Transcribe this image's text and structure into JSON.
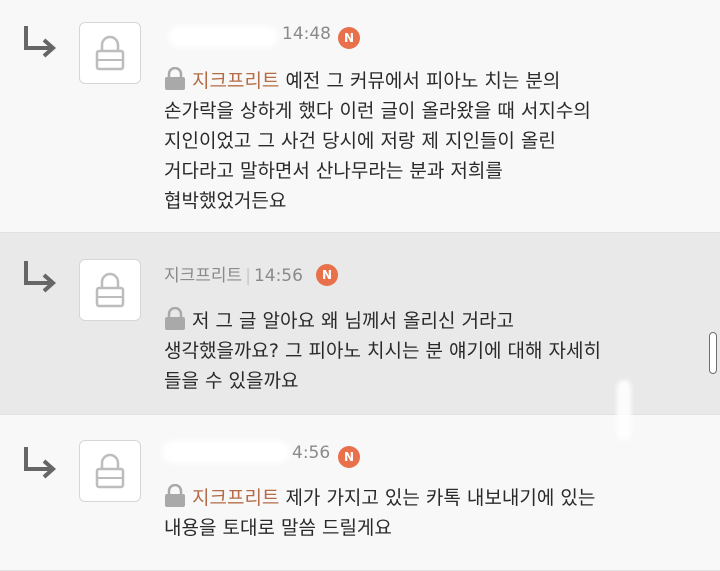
{
  "comments": [
    {
      "time": "14:48",
      "badge": "N",
      "mention": "지크프리트",
      "lines": [
        "예전 그 커뮤에서 피아노 치는 분의",
        "손가락을 상하게 했다 이런 글이 올라왔을 때 서지수의",
        "지인이었고 그 사건 당시에 저랑 제 지인들이 올린",
        "거다라고 말하면서 산나무라는 분과 저희를",
        "협박했었거든요"
      ]
    },
    {
      "author": "지크프리트",
      "time": "14:56",
      "badge": "N",
      "lines": [
        "저 그 글 알아요 왜 님께서 올리신 거라고",
        "생각했을까요? 그 피아노 치시는 분 얘기에 대해 자세히",
        "들을 수 있을까요"
      ]
    },
    {
      "time": "4:56",
      "badge": "N",
      "mention": "지크프리트",
      "lines": [
        "제가 가지고 있는 카톡 내보내기에 있는",
        "내용을 토대로 말씀 드릴게요"
      ]
    }
  ],
  "icons": {
    "reply": "reply-arrow-icon",
    "avatar": "lock-icon",
    "secret": "lock-icon",
    "new": "new-badge-icon"
  },
  "colors": {
    "badge": "#e8704a",
    "mention": "#b56b46",
    "highlight_row": "#e9e9e9"
  }
}
